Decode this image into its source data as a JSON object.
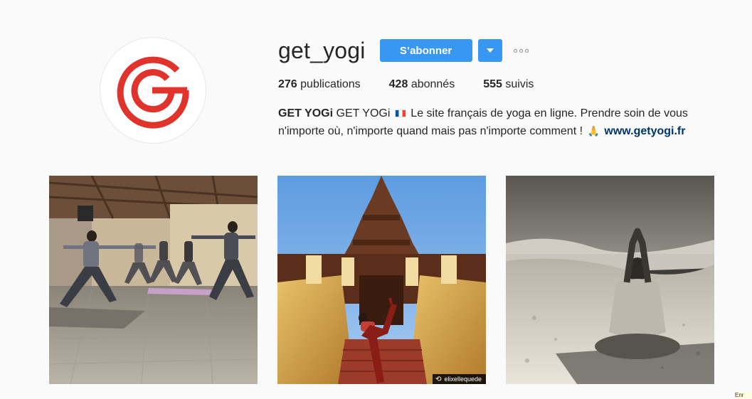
{
  "profile": {
    "username": "get_yogi",
    "follow_label": "S’abonner",
    "stats": [
      {
        "count": "276",
        "label": "publications"
      },
      {
        "count": "428",
        "label": "abonnés"
      },
      {
        "count": "555",
        "label": "suivis"
      }
    ],
    "bio": {
      "name": "GET YOGi",
      "text_before_flag": "GET YOGi",
      "text_after_flag": "Le site français de yoga en ligne. Prendre soin de vous n'importe où, n'importe quand mais pas n'importe comment !",
      "link": "www.getyogi.fr"
    }
  },
  "posts": [
    {
      "icon": "yoga-class-photo"
    },
    {
      "icon": "temple-yoga-photo",
      "repost_user": "elixellequede"
    },
    {
      "icon": "beach-meditation-photo"
    }
  ],
  "colors": {
    "accent": "#3897f0",
    "logo_red": "#e0332b",
    "link": "#003569"
  },
  "corner_tag": "Enr"
}
